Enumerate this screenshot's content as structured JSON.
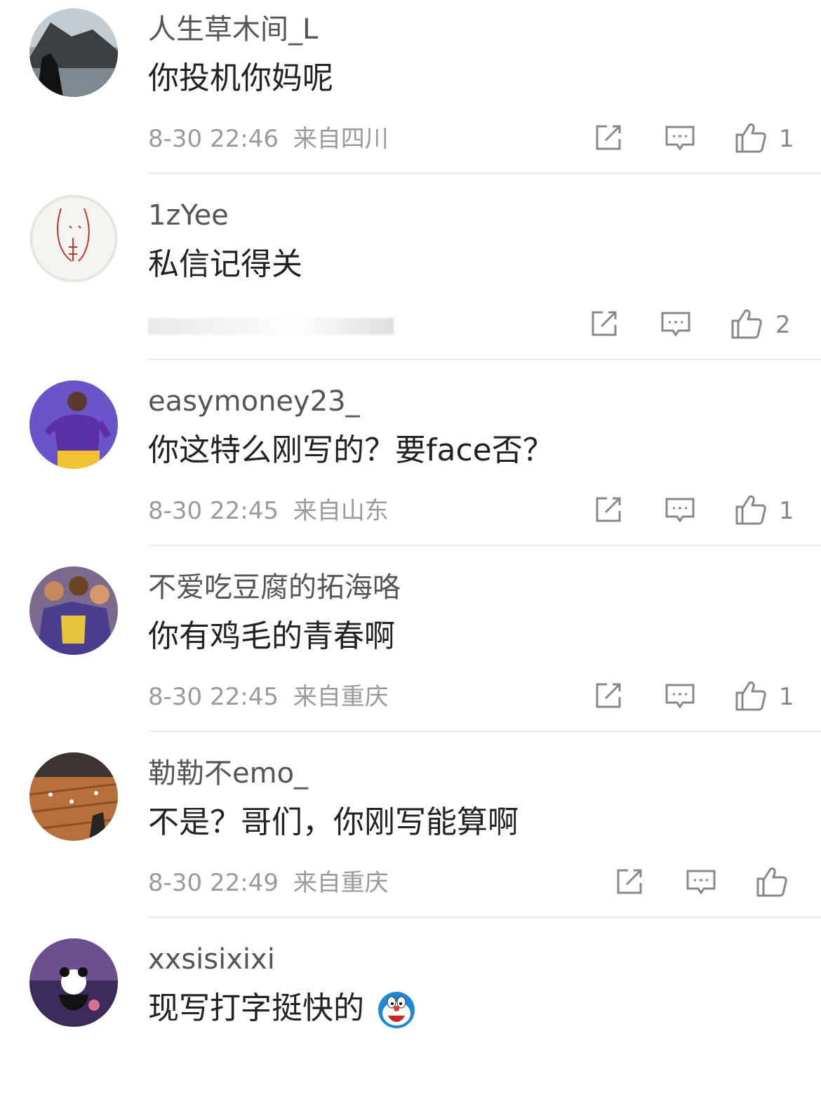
{
  "comments": [
    {
      "username": "人生草木间_L",
      "text": "你投机你妈呢",
      "time": "8-30 22:46",
      "location": "来自四川",
      "likes": "1",
      "avatar": "mountain-lake-silhouette"
    },
    {
      "username": "1zYee",
      "text": "私信记得关",
      "time": "",
      "location": "",
      "likes": "2",
      "avatar": "drawn-face-middle-finger"
    },
    {
      "username": "easymoney23_",
      "text": "你这特么刚写的？要face否？",
      "time": "8-30 22:45",
      "location": "来自山东",
      "likes": "1",
      "avatar": "basketball-player-purple"
    },
    {
      "username": "不爱吃豆腐的拓海咯",
      "text": "你有鸡毛的青春啊",
      "time": "8-30 22:45",
      "location": "来自重庆",
      "likes": "1",
      "avatar": "cartoon-basketball-team"
    },
    {
      "username": "勒勒不emo_",
      "text": "不是？哥们，你刚写能算啊",
      "time": "8-30 22:49",
      "location": "来自重庆",
      "likes": "",
      "avatar": "basketball-court"
    },
    {
      "username": "xxsisixixi",
      "text": "现写打字挺快的",
      "time": "",
      "location": "",
      "likes": "",
      "avatar": "panda-night-sky",
      "emoji": "doraemon-emoji"
    }
  ],
  "icons": {
    "share": "share-icon",
    "comment": "comment-icon",
    "like": "like-icon"
  },
  "colors": {
    "username": "#555555",
    "text": "#222222",
    "meta": "#9a9a9a",
    "divider": "#ececec",
    "icon": "#888888"
  }
}
